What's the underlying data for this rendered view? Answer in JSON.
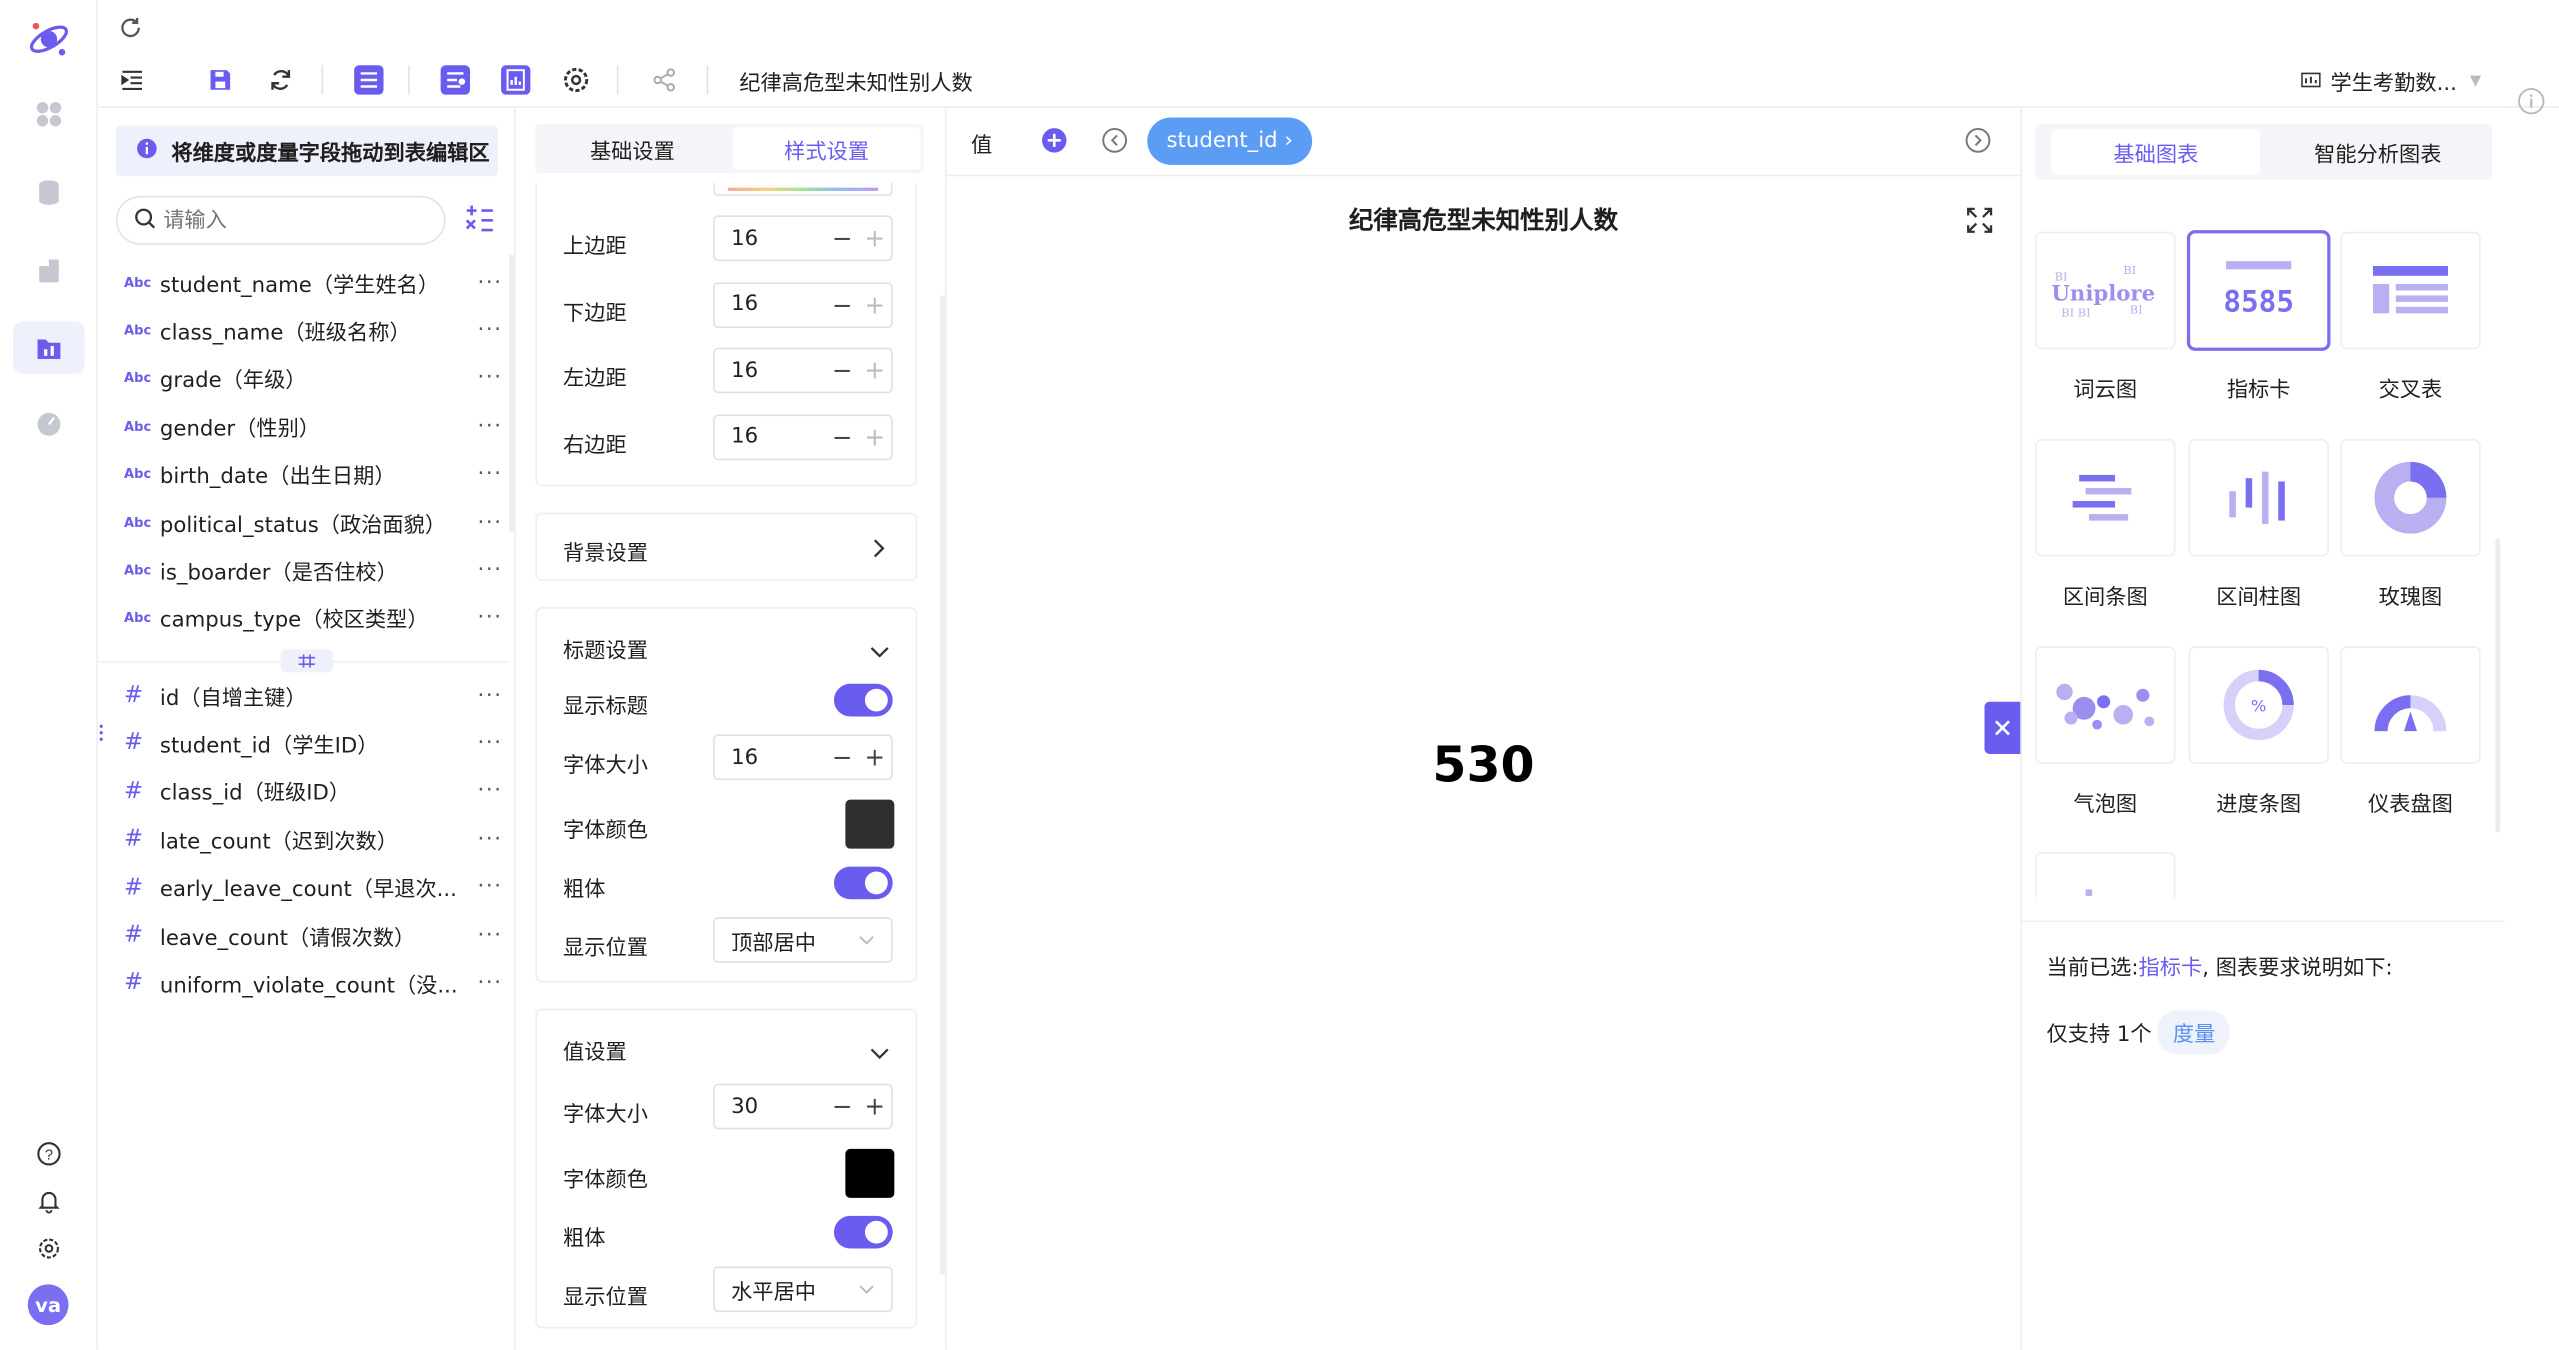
{
  "toolbar": {
    "title": "纪律高危型未知性别人数",
    "dataset": "学生考勤数...",
    "user_initials": "va"
  },
  "fields": {
    "tip": "将维度或度量字段拖动到表编辑区",
    "search_placeholder": "请输入",
    "dimensions": [
      {
        "type": "Abc",
        "label": "student_name（学生姓名）"
      },
      {
        "type": "Abc",
        "label": "class_name（班级名称）"
      },
      {
        "type": "Abc",
        "label": "grade（年级）"
      },
      {
        "type": "Abc",
        "label": "gender（性别）"
      },
      {
        "type": "Abc",
        "label": "birth_date（出生日期）"
      },
      {
        "type": "Abc",
        "label": "political_status（政治面貌）"
      },
      {
        "type": "Abc",
        "label": "is_boarder（是否住校）"
      },
      {
        "type": "Abc",
        "label": "campus_type（校区类型）"
      }
    ],
    "measures": [
      {
        "type": "#",
        "label": "id（自增主键）"
      },
      {
        "type": "#",
        "label": "student_id（学生ID）"
      },
      {
        "type": "#",
        "label": "class_id（班级ID）"
      },
      {
        "type": "#",
        "label": "late_count（迟到次数）"
      },
      {
        "type": "#",
        "label": "early_leave_count（早退次..."
      },
      {
        "type": "#",
        "label": "leave_count（请假次数）"
      },
      {
        "type": "#",
        "label": "uniform_violate_count（没..."
      }
    ],
    "more": "···"
  },
  "settings": {
    "tabs": {
      "basic": "基础设置",
      "style": "样式设置"
    },
    "margins": [
      {
        "label": "上边距",
        "value": "16"
      },
      {
        "label": "下边距",
        "value": "16"
      },
      {
        "label": "左边距",
        "value": "16"
      },
      {
        "label": "右边距",
        "value": "16"
      }
    ],
    "background": "背景设置",
    "title_section": {
      "header": "标题设置",
      "show_title": "显示标题",
      "font_size_label": "字体大小",
      "font_size": "16",
      "font_color_label": "字体颜色",
      "font_color": "#2f2f2f",
      "bold_label": "粗体",
      "position_label": "显示位置",
      "position": "顶部居中"
    },
    "value_section": {
      "header": "值设置",
      "font_size_label": "字体大小",
      "font_size": "30",
      "font_color_label": "字体颜色",
      "font_color": "#000000",
      "bold_label": "粗体",
      "position_label": "显示位置",
      "position": "水平居中"
    },
    "minus": "−",
    "plus": "+"
  },
  "canvas": {
    "value_label": "值",
    "chip": "student_id ›",
    "chart_title": "纪律高危型未知性别人数",
    "metric_value": "530"
  },
  "charts": {
    "tabs": {
      "basic": "基础图表",
      "smart": "智能分析图表"
    },
    "items": [
      {
        "label": "词云图"
      },
      {
        "label": "指标卡",
        "selected": true,
        "preview": "8585"
      },
      {
        "label": "交叉表"
      },
      {
        "label": "区间条图"
      },
      {
        "label": "区间柱图"
      },
      {
        "label": "玫瑰图"
      },
      {
        "label": "气泡图"
      },
      {
        "label": "进度条图",
        "preview": "%"
      },
      {
        "label": "仪表盘图"
      }
    ],
    "wordcloud_text": "Uniplore",
    "current_prefix": "当前已选:",
    "current_name": "指标卡",
    "current_suffix": ", 图表要求说明如下:",
    "support_prefix": "仅支持 1个",
    "support_tag": "度量"
  },
  "colors": {
    "accent": "#6b5cf0",
    "chip": "#5b9cf5"
  }
}
